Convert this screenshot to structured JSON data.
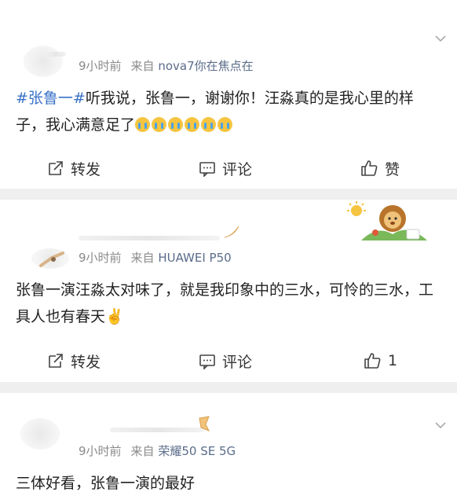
{
  "posts": [
    {
      "time": "9小时前",
      "from_label": "来自",
      "source": "nova7你在焦点在",
      "hashtag": "#张鲁一#",
      "text": "听我说，张鲁一，谢谢你！汪淼真的是我心里的样子，我心满意足了",
      "emojis": [
        "crying-emoji",
        "crying-emoji",
        "crying-emoji",
        "crying-emoji",
        "crying-emoji",
        "crying-emoji"
      ],
      "actions": {
        "repost": "转发",
        "comment": "评论",
        "like": "赞"
      }
    },
    {
      "time": "9小时前",
      "from_label": "来自",
      "source": "HUAWEI P50",
      "text": "张鲁一演汪淼太对味了，就是我印象中的三水，可怜的三水，工具人也有春天✌️",
      "actions": {
        "repost": "转发",
        "comment": "评论",
        "like": "1"
      }
    },
    {
      "time": "9小时前",
      "from_label": "来自",
      "source": "荣耀50 SE 5G",
      "text": "三体好看，张鲁一演的最好"
    }
  ],
  "colors": {
    "link": "#3a72c8",
    "meta": "#8a8a8a",
    "divider": "#efefef"
  }
}
